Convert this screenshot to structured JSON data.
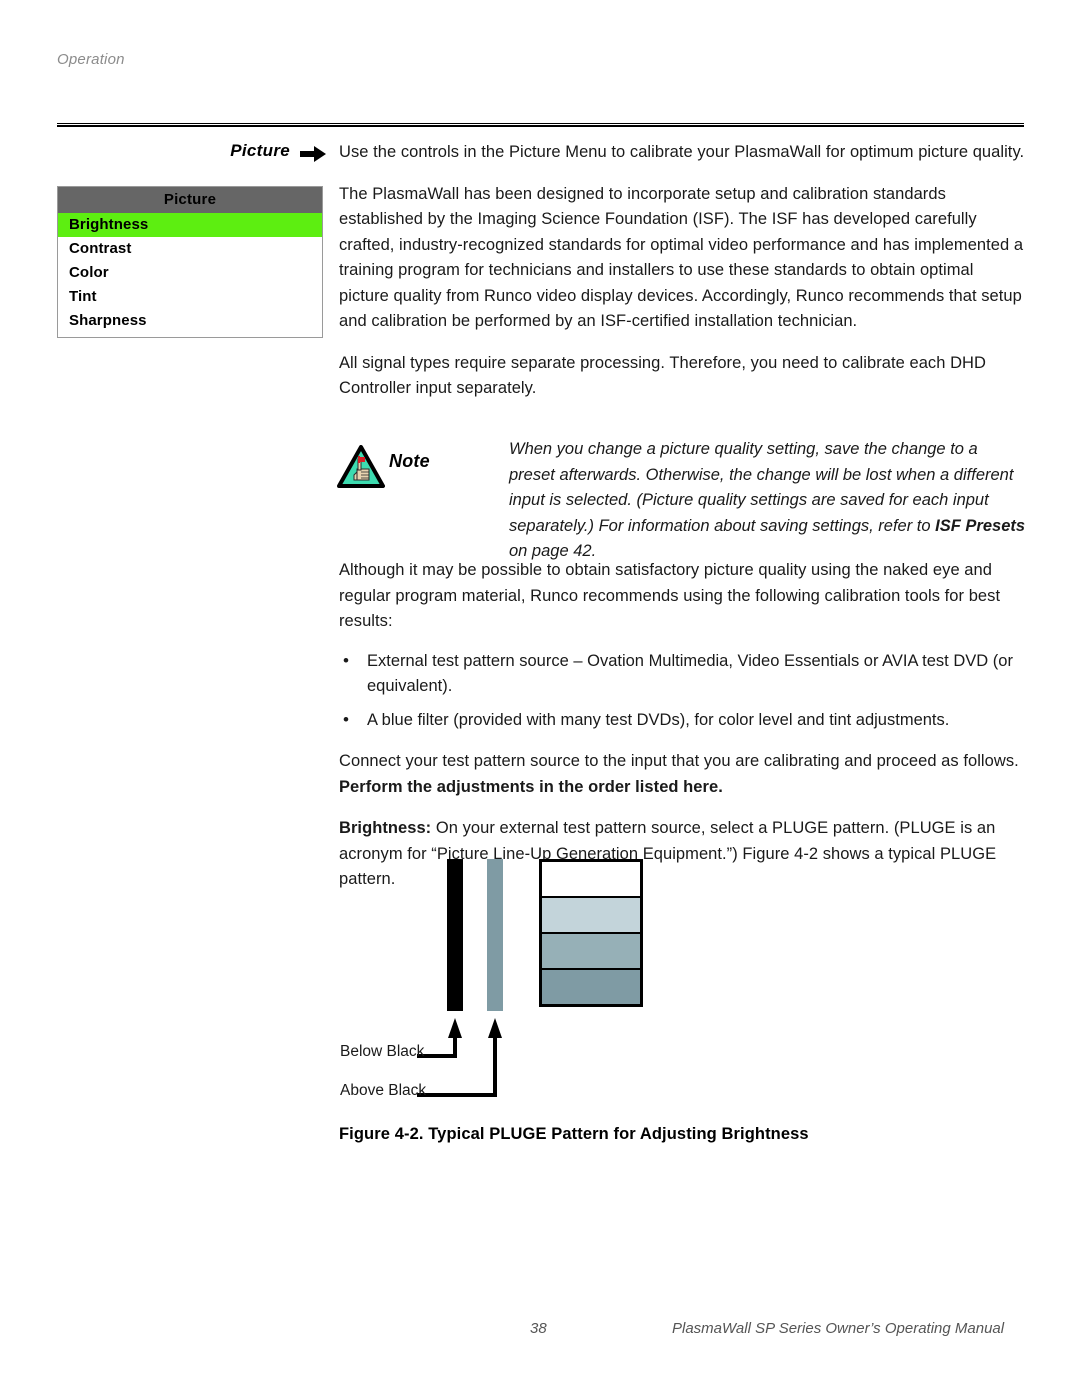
{
  "header": {
    "running_head": "Operation"
  },
  "section": {
    "label": "Picture",
    "arrow_icon": "right-triangle-arrow-icon"
  },
  "osd_menu": {
    "title": "Picture",
    "items": [
      {
        "label": "Brightness",
        "selected": true
      },
      {
        "label": "Contrast",
        "selected": false
      },
      {
        "label": "Color",
        "selected": false
      },
      {
        "label": "Tint",
        "selected": false
      },
      {
        "label": "Sharpness",
        "selected": false
      }
    ],
    "colors": {
      "title_bar": "#666666",
      "selected_row": "#5dee11",
      "border": "#9a9a9a"
    }
  },
  "body": {
    "p1": "Use the controls in the Picture Menu to calibrate your PlasmaWall for optimum picture quality.",
    "p2": "The PlasmaWall has been designed to incorporate setup and calibration standards established by the Imaging Science Foundation (ISF). The ISF has developed carefully crafted, industry-recognized standards for optimal video performance and has implemented a training program for technicians and installers to use these standards to obtain optimal picture quality from Runco video display devices. Accordingly, Runco recommends that setup and calibration be performed by an ISF-certified installation technician.",
    "p3": "All signal types require separate processing. Therefore, you need to calibrate each DHD Controller input separately.",
    "p4": "Although it may be possible to obtain satisfactory picture quality using the naked eye and regular program material, Runco recommends using the following calibration tools for best results:",
    "bullets": [
      "External test pattern source – Ovation Multimedia, Video Essentials or AVIA test DVD (or equivalent).",
      "A blue filter (provided with many test DVDs), for color level and tint adjustments."
    ],
    "p5_plain": "Connect your test pattern source to the input that you are calibrating and proceed as follows. ",
    "p5_bold": "Perform the adjustments in the order listed here.",
    "p6_bold": "Brightness:",
    "p6_plain": " On your external test pattern source, select a PLUGE pattern. (PLUGE is an acronym for “Picture Line-Up Generation Equipment.”) Figure 4-2 shows a typical PLUGE pattern."
  },
  "note": {
    "icon": "note-triangle-hand-icon",
    "word": "Note",
    "text_part1": "When you change a picture quality setting, save the change to a preset afterwards. Otherwise, the change will be lost when a different input is selected. (Picture quality settings are saved for each input separately.) For information about saving settings, refer to ",
    "text_bold": "ISF Presets",
    "text_part2": " on page 42.",
    "icon_colors": {
      "triangle_fill": "#3ddbb0",
      "triangle_stroke": "#000000",
      "hand": "#e8d4b0",
      "accent": "#d81f26"
    }
  },
  "figure": {
    "caption": "Figure 4-2. Typical PLUGE Pattern for Adjusting Brightness",
    "label_below_black": "Below Black",
    "label_above_black": "Above Black",
    "bars": [
      {
        "name": "below-black-bar",
        "color": "#000000"
      },
      {
        "name": "above-black-bar",
        "color": "#7f9ba4"
      }
    ],
    "steps": [
      {
        "name": "step-white",
        "color": "#ffffff"
      },
      {
        "name": "step-light-gray",
        "color": "#c3d4da"
      },
      {
        "name": "step-medium-gray",
        "color": "#96b0b7"
      },
      {
        "name": "step-dark-gray",
        "color": "#7f9ba4"
      }
    ]
  },
  "footer": {
    "page_number": "38",
    "manual_title": "PlasmaWall SP Series Owner’s Operating Manual"
  }
}
